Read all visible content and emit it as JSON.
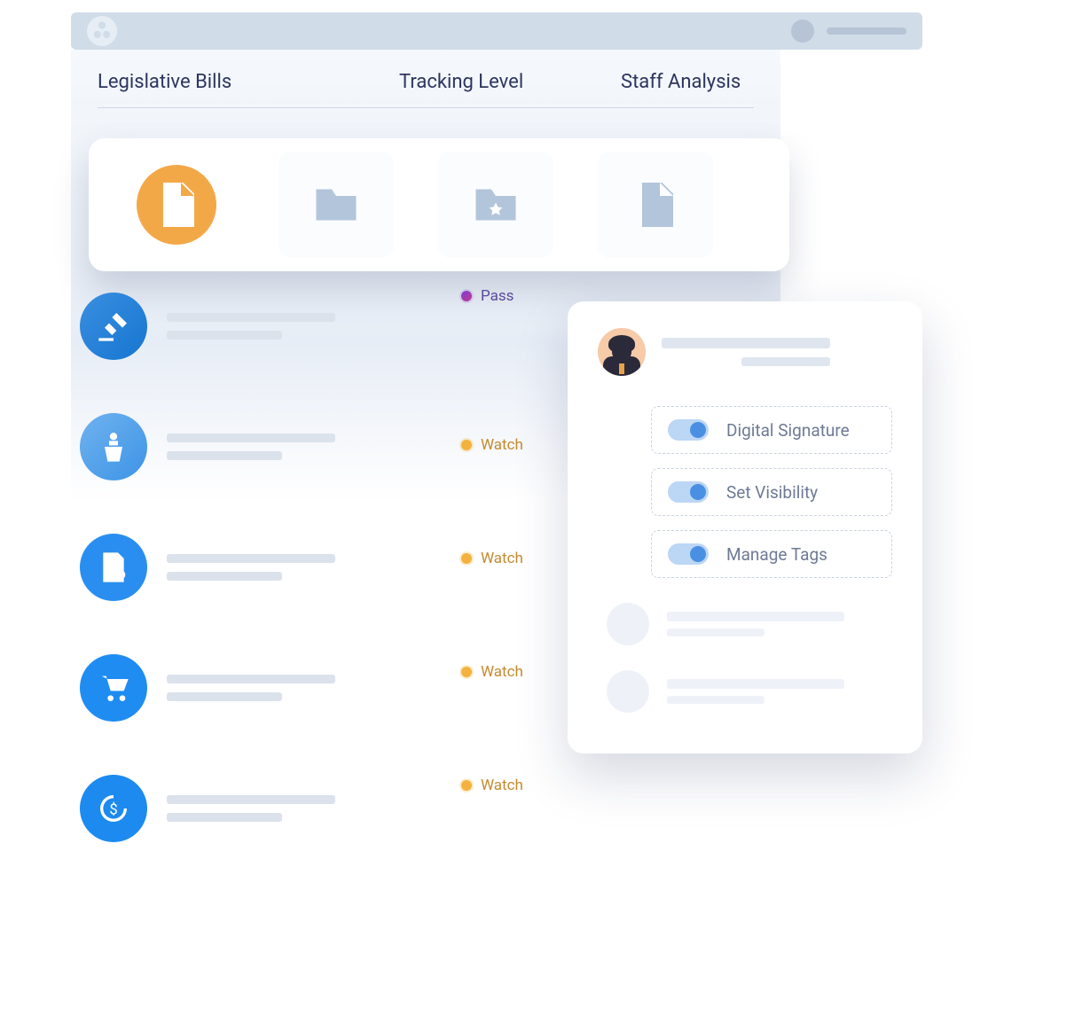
{
  "columns": {
    "legislative": "Legislative Bills",
    "tracking": "Tracking Level",
    "staff": "Staff Analysis"
  },
  "tracking_status": {
    "row0": "Pass",
    "row1": "Watch",
    "row2": "Watch",
    "row3": "Watch",
    "row4": "Watch"
  },
  "side_panel": {
    "toggles": {
      "t0": {
        "label": "Digital Signature",
        "on": true
      },
      "t1": {
        "label": "Set Visibility",
        "on": true
      },
      "t2": {
        "label": "Manage Tags",
        "on": true
      }
    }
  },
  "card_strip": {
    "items": [
      "document",
      "folder",
      "starred-folder",
      "file"
    ]
  },
  "colors": {
    "accent_orange": "#f3a847",
    "accent_blue": "#2a8ef0",
    "status_pass": "#5a4a9c",
    "status_watch": "#c58a2e"
  }
}
